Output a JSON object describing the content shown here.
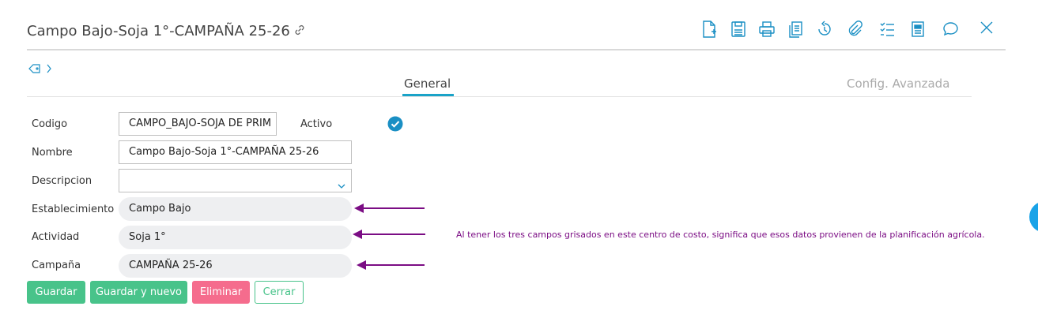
{
  "header": {
    "title": "Campo Bajo-Soja 1°-CAMPAÑA 25-26",
    "toolbar_icons": [
      "new-document-icon",
      "save-icon",
      "print-icon",
      "copy-icon",
      "history-icon",
      "attachment-icon",
      "checklist-icon",
      "report-icon",
      "comment-icon"
    ],
    "close_icon": "close-icon"
  },
  "tabs": [
    {
      "label": "General",
      "active": true
    },
    {
      "label": "Config. Avanzada",
      "active": false
    }
  ],
  "form": {
    "codigo": {
      "label": "Codigo",
      "value": "CAMPO_BAJO-SOJA DE PRIM"
    },
    "activo": {
      "label": "Activo",
      "checked": true
    },
    "nombre": {
      "label": "Nombre",
      "value": "Campo Bajo-Soja 1°-CAMPAÑA 25-26"
    },
    "descripcion": {
      "label": "Descripcion",
      "value": ""
    },
    "establecimiento": {
      "label": "Establecimiento",
      "value": "Campo Bajo"
    },
    "actividad": {
      "label": "Actividad",
      "value": "Soja 1°"
    },
    "campana": {
      "label": "Campaña",
      "value": "CAMPAÑA 25-26"
    }
  },
  "annotation": {
    "text": "Al tener los tres campos grisados en este centro de costo, significa que esos datos provienen de la planificación agrícola.",
    "color": "#7b0d84"
  },
  "buttons": {
    "save": "Guardar",
    "save_new": "Guardar y nuevo",
    "delete": "Eliminar",
    "close": "Cerrar"
  },
  "colors": {
    "accent": "#1aa3c8",
    "toolbar_icon": "#1a8fc4",
    "success": "#48c38a",
    "danger": "#f56c8d"
  }
}
